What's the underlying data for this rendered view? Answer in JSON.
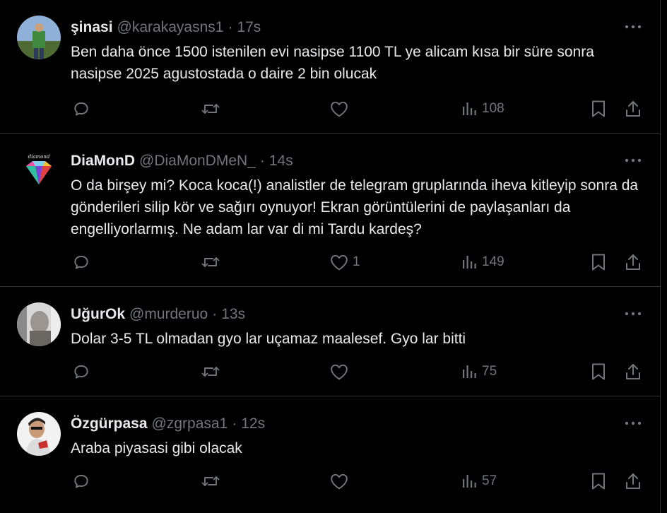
{
  "colors": {
    "background": "#000000",
    "text_primary": "#e7e9ea",
    "text_secondary": "#71767b",
    "divider": "#2f3336"
  },
  "icons": {
    "reply": "reply-icon",
    "retweet": "retweet-icon",
    "like": "heart-icon",
    "views": "views-icon",
    "bookmark": "bookmark-icon",
    "share": "share-icon",
    "more": "more-icon"
  },
  "tweets": [
    {
      "name": "şinasi",
      "handle": "@karakayasns1",
      "separator": "·",
      "time": "17s",
      "text": "Ben daha önce 1500 istenilen evi nasipse 1100 TL ye alicam kısa bir süre sonra nasipse 2025 agustostada o daire 2 bin olucak",
      "likes": "",
      "views": "108"
    },
    {
      "name": "DiaMonD",
      "handle": "@DiaMonDMeN_",
      "separator": "·",
      "time": "14s",
      "text": "O da birşey mi? Koca koca(!) analistler de telegram gruplarında iheva kitleyip sonra da gönderileri silip kör ve sağırı oynuyor! Ekran görüntülerini de paylaşanları da engelliyorlarmış. Ne adam lar var di mi Tardu kardeş?",
      "likes": "1",
      "views": "149",
      "avatar_caption": "diamond"
    },
    {
      "name": "UğurOk",
      "handle": "@murderuo",
      "separator": "·",
      "time": "13s",
      "text": "Dolar 3-5 TL olmadan gyo lar uçamaz maalesef. Gyo lar bitti",
      "likes": "",
      "views": "75"
    },
    {
      "name": "Özgürpasa",
      "handle": "@zgrpasa1",
      "separator": "·",
      "time": "12s",
      "text": "Araba piyasasi gibi olacak",
      "likes": "",
      "views": "57"
    }
  ]
}
